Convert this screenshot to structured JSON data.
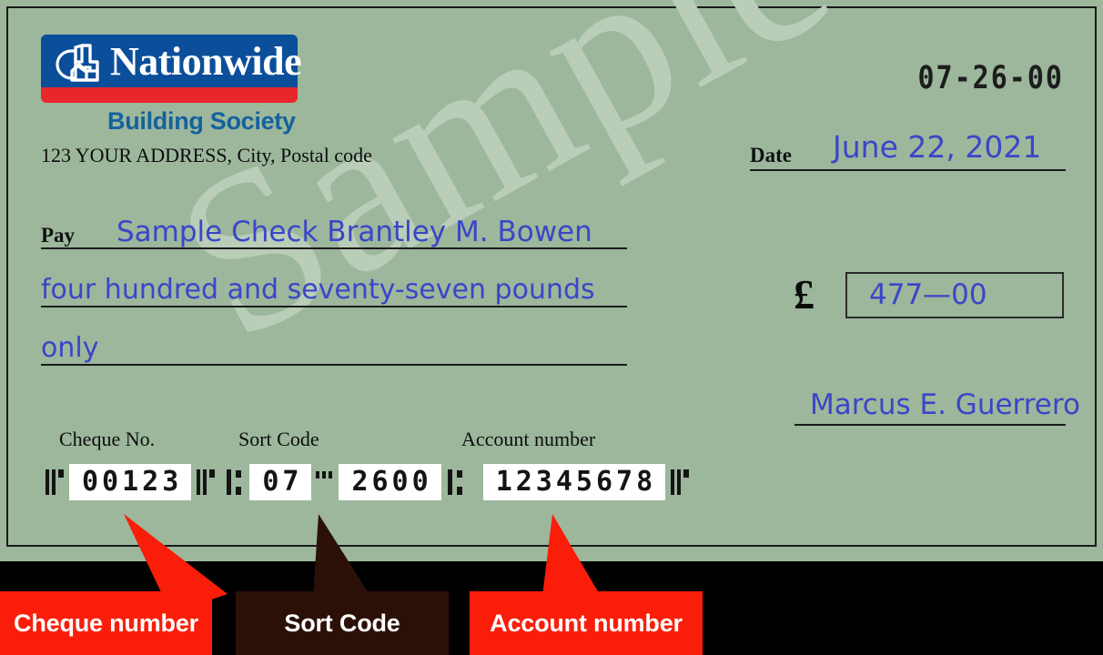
{
  "cheque": {
    "bank": {
      "name": "Nationwide",
      "subtitle": "Building Society",
      "logo_icon": "nationwide-house-hand-icon",
      "brand_blue": "#0b4f9a",
      "brand_red": "#e8262c",
      "subtitle_blue": "#14629e"
    },
    "address": "123 YOUR ADDRESS, City, Postal code",
    "sort_code_printed": "07-26-00",
    "watermark": "Sample",
    "date": {
      "label": "Date",
      "value": "June 22, 2021"
    },
    "pay": {
      "label": "Pay",
      "payee": "Sample Check Brantley M. Bowen"
    },
    "amount_words": {
      "line1": "four hundred and seventy-seven pounds",
      "line2": "only"
    },
    "amount": {
      "currency_symbol": "£",
      "value": "477—00"
    },
    "signature": "Marcus E. Guerrero",
    "micr": {
      "labels": {
        "cheque_no": "Cheque No.",
        "sort_code": "Sort Code",
        "account_number": "Account number"
      },
      "cheque_no": "00123",
      "sort_code_part1": "07",
      "sort_code_part2": "2600",
      "account_number": "12345678"
    },
    "ink_color": "#3a46c8",
    "paper_color": "#9cb79c"
  },
  "callouts": [
    {
      "label": "Cheque number",
      "color": "#fa1e0a"
    },
    {
      "label": "Sort Code",
      "color": "#2b1008"
    },
    {
      "label": "Account number",
      "color": "#fa1e0a"
    }
  ]
}
